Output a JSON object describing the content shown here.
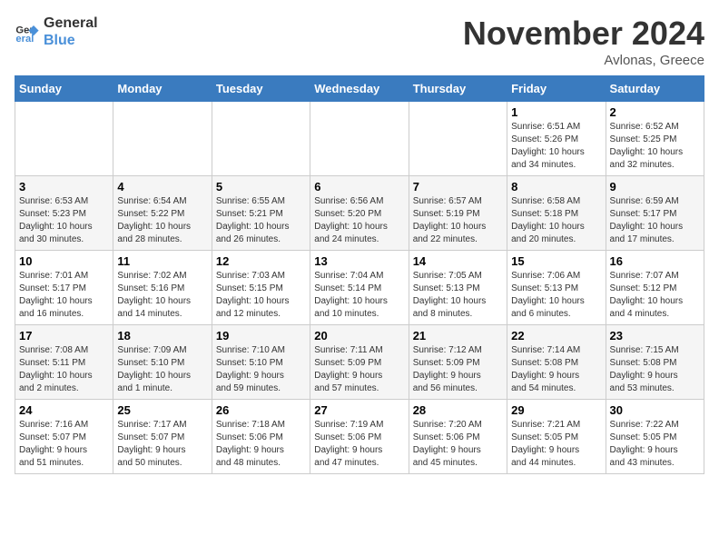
{
  "logo": {
    "line1": "General",
    "line2": "Blue"
  },
  "title": "November 2024",
  "subtitle": "Avlonas, Greece",
  "days_of_week": [
    "Sunday",
    "Monday",
    "Tuesday",
    "Wednesday",
    "Thursday",
    "Friday",
    "Saturday"
  ],
  "weeks": [
    [
      {
        "day": "",
        "info": ""
      },
      {
        "day": "",
        "info": ""
      },
      {
        "day": "",
        "info": ""
      },
      {
        "day": "",
        "info": ""
      },
      {
        "day": "",
        "info": ""
      },
      {
        "day": "1",
        "info": "Sunrise: 6:51 AM\nSunset: 5:26 PM\nDaylight: 10 hours\nand 34 minutes."
      },
      {
        "day": "2",
        "info": "Sunrise: 6:52 AM\nSunset: 5:25 PM\nDaylight: 10 hours\nand 32 minutes."
      }
    ],
    [
      {
        "day": "3",
        "info": "Sunrise: 6:53 AM\nSunset: 5:23 PM\nDaylight: 10 hours\nand 30 minutes."
      },
      {
        "day": "4",
        "info": "Sunrise: 6:54 AM\nSunset: 5:22 PM\nDaylight: 10 hours\nand 28 minutes."
      },
      {
        "day": "5",
        "info": "Sunrise: 6:55 AM\nSunset: 5:21 PM\nDaylight: 10 hours\nand 26 minutes."
      },
      {
        "day": "6",
        "info": "Sunrise: 6:56 AM\nSunset: 5:20 PM\nDaylight: 10 hours\nand 24 minutes."
      },
      {
        "day": "7",
        "info": "Sunrise: 6:57 AM\nSunset: 5:19 PM\nDaylight: 10 hours\nand 22 minutes."
      },
      {
        "day": "8",
        "info": "Sunrise: 6:58 AM\nSunset: 5:18 PM\nDaylight: 10 hours\nand 20 minutes."
      },
      {
        "day": "9",
        "info": "Sunrise: 6:59 AM\nSunset: 5:17 PM\nDaylight: 10 hours\nand 17 minutes."
      }
    ],
    [
      {
        "day": "10",
        "info": "Sunrise: 7:01 AM\nSunset: 5:17 PM\nDaylight: 10 hours\nand 16 minutes."
      },
      {
        "day": "11",
        "info": "Sunrise: 7:02 AM\nSunset: 5:16 PM\nDaylight: 10 hours\nand 14 minutes."
      },
      {
        "day": "12",
        "info": "Sunrise: 7:03 AM\nSunset: 5:15 PM\nDaylight: 10 hours\nand 12 minutes."
      },
      {
        "day": "13",
        "info": "Sunrise: 7:04 AM\nSunset: 5:14 PM\nDaylight: 10 hours\nand 10 minutes."
      },
      {
        "day": "14",
        "info": "Sunrise: 7:05 AM\nSunset: 5:13 PM\nDaylight: 10 hours\nand 8 minutes."
      },
      {
        "day": "15",
        "info": "Sunrise: 7:06 AM\nSunset: 5:13 PM\nDaylight: 10 hours\nand 6 minutes."
      },
      {
        "day": "16",
        "info": "Sunrise: 7:07 AM\nSunset: 5:12 PM\nDaylight: 10 hours\nand 4 minutes."
      }
    ],
    [
      {
        "day": "17",
        "info": "Sunrise: 7:08 AM\nSunset: 5:11 PM\nDaylight: 10 hours\nand 2 minutes."
      },
      {
        "day": "18",
        "info": "Sunrise: 7:09 AM\nSunset: 5:10 PM\nDaylight: 10 hours\nand 1 minute."
      },
      {
        "day": "19",
        "info": "Sunrise: 7:10 AM\nSunset: 5:10 PM\nDaylight: 9 hours\nand 59 minutes."
      },
      {
        "day": "20",
        "info": "Sunrise: 7:11 AM\nSunset: 5:09 PM\nDaylight: 9 hours\nand 57 minutes."
      },
      {
        "day": "21",
        "info": "Sunrise: 7:12 AM\nSunset: 5:09 PM\nDaylight: 9 hours\nand 56 minutes."
      },
      {
        "day": "22",
        "info": "Sunrise: 7:14 AM\nSunset: 5:08 PM\nDaylight: 9 hours\nand 54 minutes."
      },
      {
        "day": "23",
        "info": "Sunrise: 7:15 AM\nSunset: 5:08 PM\nDaylight: 9 hours\nand 53 minutes."
      }
    ],
    [
      {
        "day": "24",
        "info": "Sunrise: 7:16 AM\nSunset: 5:07 PM\nDaylight: 9 hours\nand 51 minutes."
      },
      {
        "day": "25",
        "info": "Sunrise: 7:17 AM\nSunset: 5:07 PM\nDaylight: 9 hours\nand 50 minutes."
      },
      {
        "day": "26",
        "info": "Sunrise: 7:18 AM\nSunset: 5:06 PM\nDaylight: 9 hours\nand 48 minutes."
      },
      {
        "day": "27",
        "info": "Sunrise: 7:19 AM\nSunset: 5:06 PM\nDaylight: 9 hours\nand 47 minutes."
      },
      {
        "day": "28",
        "info": "Sunrise: 7:20 AM\nSunset: 5:06 PM\nDaylight: 9 hours\nand 45 minutes."
      },
      {
        "day": "29",
        "info": "Sunrise: 7:21 AM\nSunset: 5:05 PM\nDaylight: 9 hours\nand 44 minutes."
      },
      {
        "day": "30",
        "info": "Sunrise: 7:22 AM\nSunset: 5:05 PM\nDaylight: 9 hours\nand 43 minutes."
      }
    ]
  ]
}
